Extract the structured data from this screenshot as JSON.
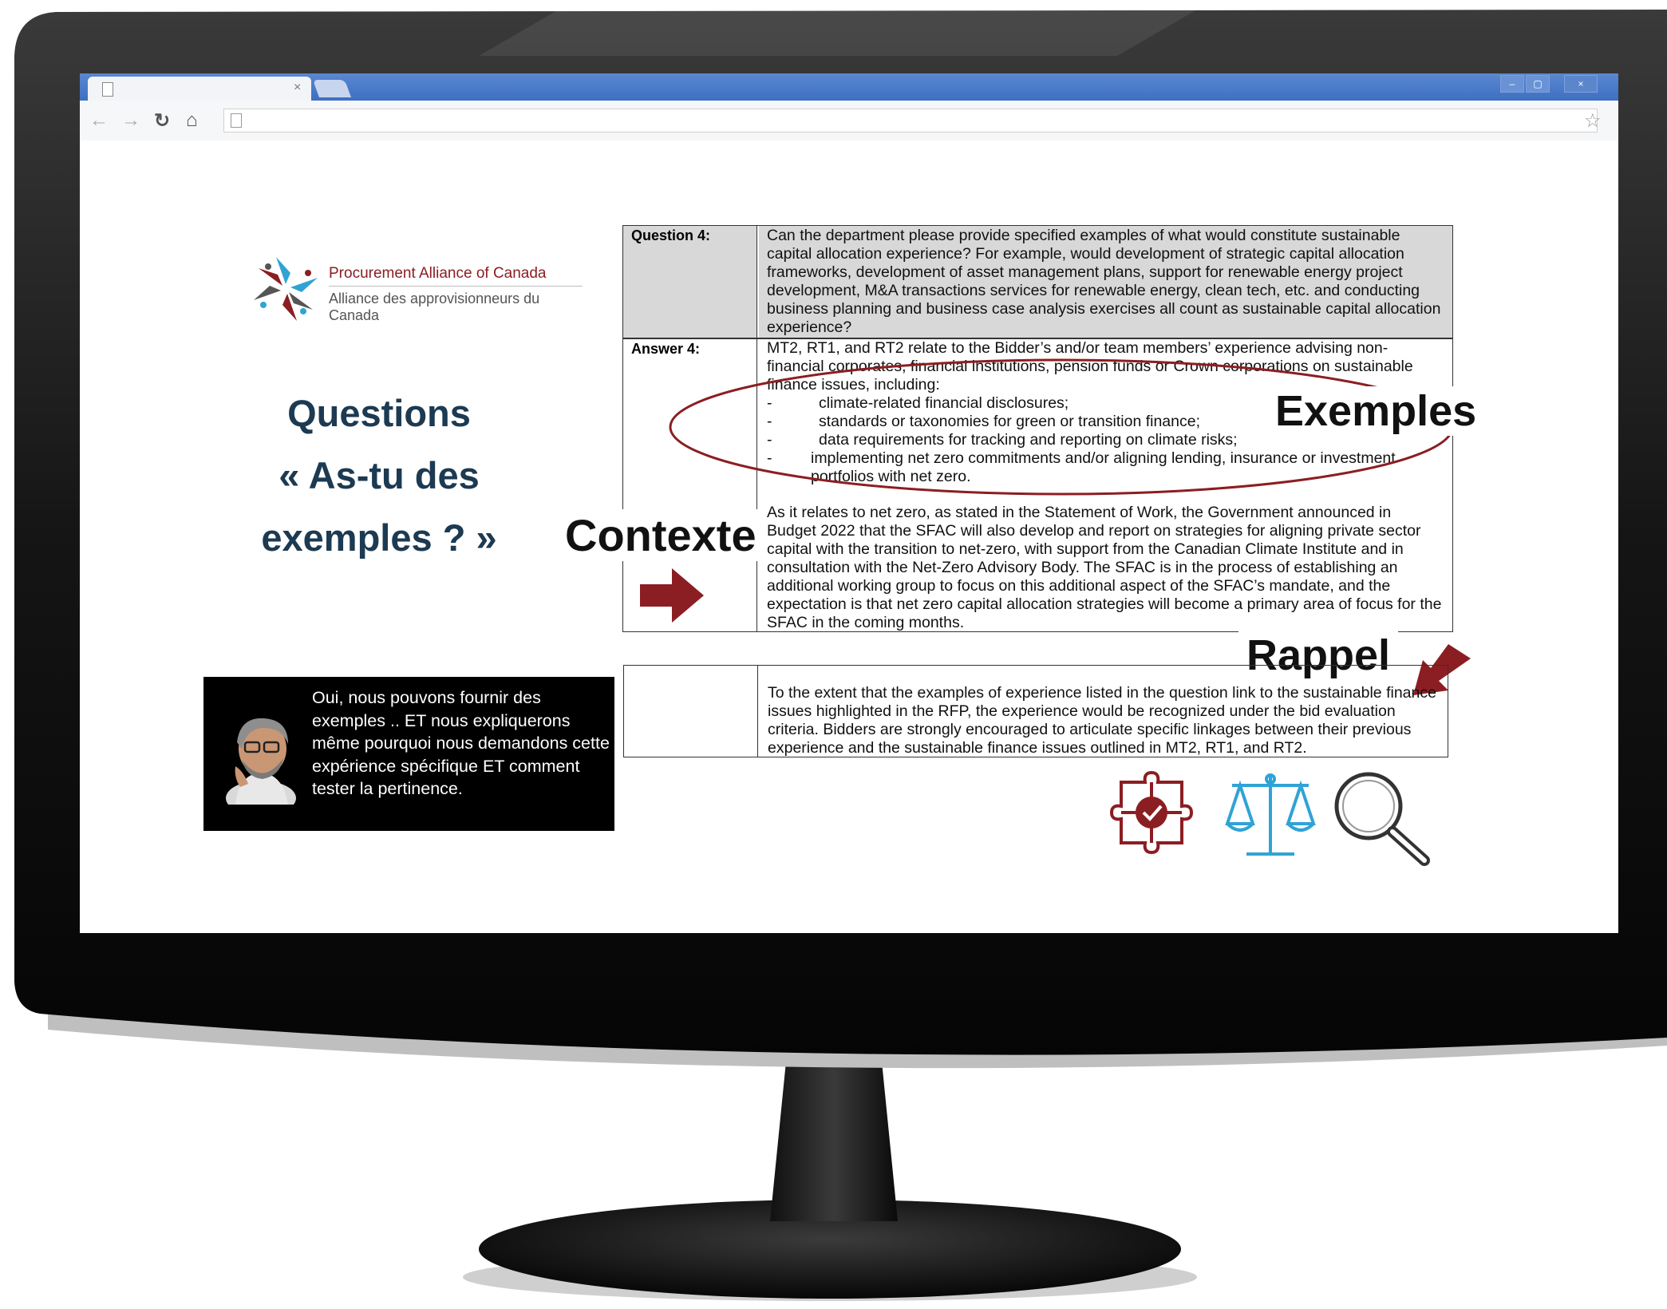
{
  "browser": {
    "tab_title": "",
    "tab_close": "×",
    "window_controls": [
      "–",
      "▢",
      "×"
    ],
    "nav_icons": [
      "back-icon",
      "forward-icon",
      "reload-icon",
      "home-icon",
      "page-icon",
      "star-icon"
    ],
    "address": ""
  },
  "logo": {
    "name_en": "Procurement Alliance of Canada",
    "name_fr": "Alliance des approvisionneurs du Canada"
  },
  "heading": {
    "line1": "Questions",
    "line2": "« As-tu des",
    "line3": "exemples ? »"
  },
  "labels": {
    "contexte": "Contexte",
    "exemples": "Exemples",
    "rappel": "Rappel"
  },
  "table": {
    "question_label": "Question 4:",
    "question_text": "Can the department please provide specified examples of what would constitute sustainable capital allocation experience? For example, would development of strategic capital allocation frameworks, development of asset management plans, support for renewable energy project development, M&A transactions services for renewable energy, clean tech, etc. and conducting business planning and business case analysis exercises all count as sustainable capital allocation experience?",
    "answer_label": "Answer 4:",
    "answer_intro": "MT2, RT1, and RT2 relate to the Bidder’s and/or team members’ experience advising non-financial corporates, financial institutions, pension funds or Crown corporations on sustainable finance issues, including:",
    "bullets": [
      "climate-related financial disclosures;",
      "standards or taxonomies for green or transition finance;",
      "data requirements for tracking and reporting on climate risks;",
      "implementing net zero commitments and/or aligning lending, insurance or investment portfolios with net zero."
    ],
    "bullet_marker": "-",
    "context_text": "As it relates to net zero, as stated in the Statement of Work, the Government announced in Budget 2022 that the SFAC will also develop and report on strategies for aligning private sector capital with the transition to net-zero, with support from the Canadian Climate Institute and in consultation with the Net-Zero Advisory Body. The SFAC is in the process of establishing an additional working group to focus on this additional aspect of the SFAC’s mandate, and the expectation is that net zero capital allocation strategies will become a primary area of focus for the SFAC in the coming months.",
    "reminder_text": "To the extent that the examples of experience listed in the question link to the sustainable finance issues highlighted in the RFP, the experience would be recognized under the bid evaluation criteria. Bidders are strongly encouraged to articulate specific linkages between their previous experience and the sustainable finance issues outlined in MT2, RT1, and RT2."
  },
  "callout": {
    "text": "Oui, nous pouvons fournir des exemples .. ET nous expliquerons même pourquoi nous demandons cette expérience spécifique ET comment tester la pertinence."
  },
  "icons": [
    "puzzle-check-icon",
    "scales-icon",
    "magnifier-icon"
  ],
  "colors": {
    "accent_red": "#8b1e22",
    "accent_blue": "#2fa3d6",
    "title_navy": "#1c3a52",
    "tab_blue": "#3e6fc2"
  }
}
